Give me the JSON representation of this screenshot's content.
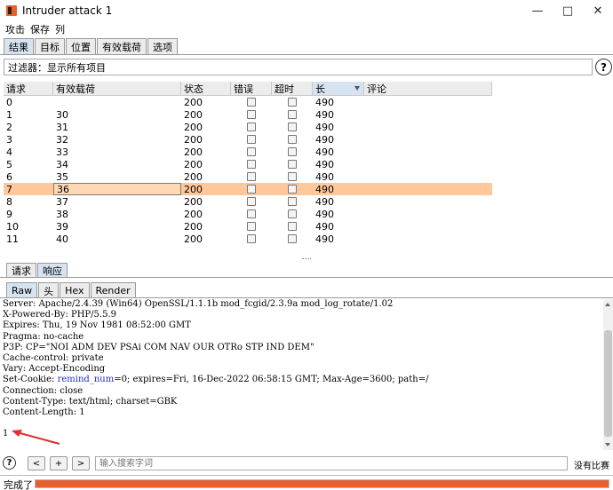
{
  "window": {
    "title": "Intruder attack 1"
  },
  "menu": [
    "攻击",
    "保存",
    "列"
  ],
  "top_tabs": [
    {
      "label": "结果",
      "active": true
    },
    {
      "label": "目标",
      "active": false
    },
    {
      "label": "位置",
      "active": false
    },
    {
      "label": "有效载荷",
      "active": false
    },
    {
      "label": "选项",
      "active": false
    }
  ],
  "filter": {
    "text": "过滤器：显示所有项目"
  },
  "table": {
    "columns": [
      "请求",
      "有效载荷",
      "状态",
      "错误",
      "超时",
      "长",
      "评论"
    ],
    "sorted_column": "长",
    "rows": [
      {
        "req": "0",
        "payload": "",
        "status": "200",
        "length": "490"
      },
      {
        "req": "1",
        "payload": "30",
        "status": "200",
        "length": "490"
      },
      {
        "req": "2",
        "payload": "31",
        "status": "200",
        "length": "490"
      },
      {
        "req": "3",
        "payload": "32",
        "status": "200",
        "length": "490"
      },
      {
        "req": "4",
        "payload": "33",
        "status": "200",
        "length": "490"
      },
      {
        "req": "5",
        "payload": "34",
        "status": "200",
        "length": "490"
      },
      {
        "req": "6",
        "payload": "35",
        "status": "200",
        "length": "490"
      },
      {
        "req": "7",
        "payload": "36",
        "status": "200",
        "length": "490",
        "selected": true
      },
      {
        "req": "8",
        "payload": "37",
        "status": "200",
        "length": "490"
      },
      {
        "req": "9",
        "payload": "38",
        "status": "200",
        "length": "490"
      },
      {
        "req": "10",
        "payload": "39",
        "status": "200",
        "length": "490"
      },
      {
        "req": "11",
        "payload": "40",
        "status": "200",
        "length": "490"
      }
    ]
  },
  "rr_tabs": [
    {
      "label": "请求",
      "active": false
    },
    {
      "label": "响应",
      "active": true
    }
  ],
  "view_tabs": [
    {
      "label": "Raw",
      "active": true
    },
    {
      "label": "头",
      "active": false
    },
    {
      "label": "Hex",
      "active": false
    },
    {
      "label": "Render",
      "active": false
    }
  ],
  "response": {
    "lines": [
      "Server: Apache/2.4.39 (Win64) OpenSSL/1.1.1b mod_fcgid/2.3.9a mod_log_rotate/1.02",
      "X-Powered-By: PHP/5.5.9",
      "Expires: Thu, 19 Nov 1981 08:52:00 GMT",
      "Pragma: no-cache",
      "P3P: CP=\"NOI ADM DEV PSAi COM NAV OUR OTRo STP IND DEM\"",
      "Cache-control: private",
      "Vary: Accept-Encoding",
      "Set-Cookie: remind_num=0; expires=Fri, 16-Dec-2022 06:58:15 GMT; Max-Age=3600; path=/",
      "Connection: close",
      "Content-Type: text/html; charset=GBK",
      "Content-Length: 1",
      "",
      "1"
    ],
    "highlight_keyword": "remind_num"
  },
  "search": {
    "prev_label": "<",
    "add_label": "+",
    "next_label": ">",
    "placeholder": "输入搜索字词",
    "match_count": "没有比赛"
  },
  "status": {
    "text": "完成了",
    "progress": 1.0,
    "progress_color": "#e8602c"
  },
  "colors": {
    "selected_row": "#ffc79a",
    "active_tab": "#d6e4f2",
    "keyword": "#1d2fc5",
    "arrow": "#e03030"
  }
}
